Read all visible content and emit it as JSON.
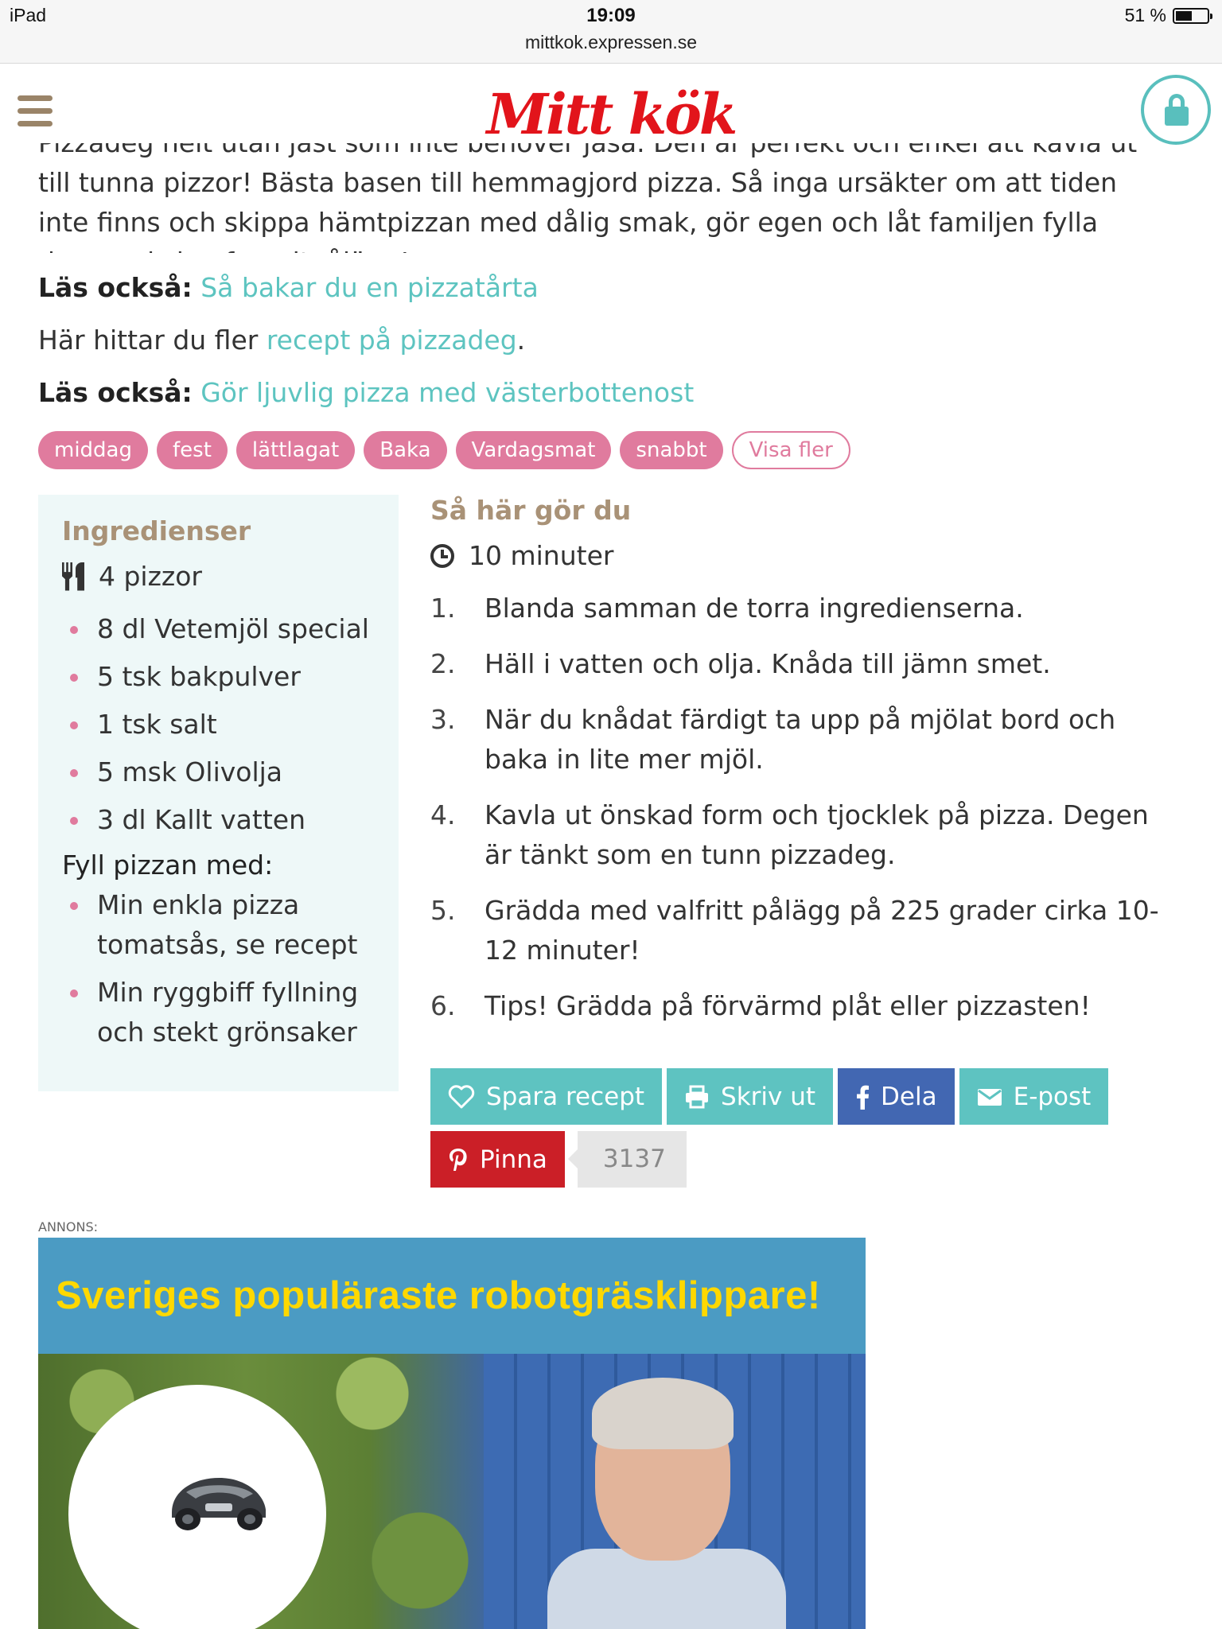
{
  "status": {
    "device": "iPad",
    "time": "19:09",
    "battery": "51 %",
    "url": "mittkok.expressen.se"
  },
  "header": {
    "logo": "Mitt kök"
  },
  "intro": {
    "text": "Pizzadeg helt utan jäst som inte behöver jäsa. Den är perfekt och enkel att kavla ut till tunna pizzor! Bästa basen till hemmagjord pizza. Så inga ursäkter om att tiden inte finns och skippa hämtpizzan med dålig smak, gör egen och låt familjen fylla den med sina favoritpålägg!"
  },
  "readmore": [
    {
      "prefix": "Läs också:",
      "link": "Så bakar du en pizzatårta"
    },
    {
      "text": "Här hittar du fler ",
      "link": "recept på pizzadeg",
      "suffix": "."
    },
    {
      "prefix": "Läs också:",
      "link": "Gör ljuvlig pizza med västerbottenost"
    }
  ],
  "tags": [
    "middag",
    "fest",
    "lättlagat",
    "Baka",
    "Vardagsmat",
    "snabbt"
  ],
  "tags_more": "Visa fler",
  "ingredients": {
    "title": "Ingredienser",
    "portions": "4 pizzor",
    "items": [
      "8 dl Vetemjöl special",
      "5 tsk bakpulver",
      "1 tsk salt",
      "5 msk Olivolja",
      "3 dl Kallt vatten"
    ],
    "fill_title": "Fyll pizzan med:",
    "fill_items": [
      "Min enkla pizza tomatsås, se recept",
      "Min ryggbiff fyllning och stekt grönsaker"
    ]
  },
  "steps": {
    "title": "Så här gör du",
    "time": "10 minuter",
    "items": [
      {
        "num": "1.",
        "text": "Blanda samman de torra ingredienserna."
      },
      {
        "num": "2.",
        "text": "Häll i vatten och olja. Knåda till jämn smet."
      },
      {
        "num": "3.",
        "text": "När du knådat färdigt ta upp på mjölat bord och baka in lite mer mjöl."
      },
      {
        "num": "4.",
        "text": "Kavla ut önskad form och tjocklek på pizza. Degen är tänkt som en tunn pizzadeg."
      },
      {
        "num": "5.",
        "text": "Grädda med valfritt pålägg på 225 grader cirka 10-12 minuter!"
      },
      {
        "num": "6.",
        "text": "Tips! Grädda på förvärmd plåt eller pizzasten!"
      }
    ]
  },
  "share": {
    "save": "Spara recept",
    "print": "Skriv ut",
    "facebook": "Dela",
    "email": "E-post",
    "pin": "Pinna",
    "pin_count": "3137"
  },
  "ad": {
    "label": "ANNONS:",
    "title": "Sveriges populäraste robotgräsklippare!"
  },
  "colors": {
    "accent": "#5dc4c0",
    "tag": "#e07b9e",
    "heading": "#a99277",
    "logo": "#e2141b",
    "facebook": "#4267b2",
    "pinterest": "#cb1f27"
  }
}
